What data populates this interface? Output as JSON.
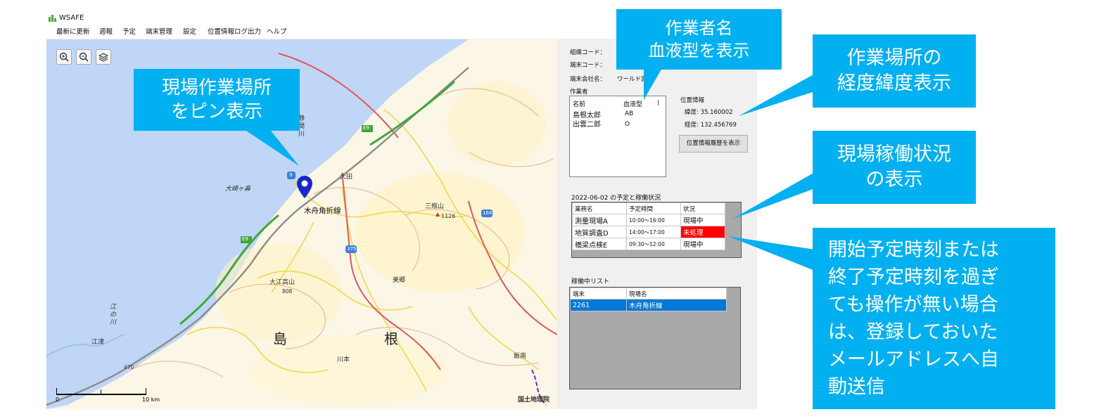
{
  "window": {
    "title": "WSAFE"
  },
  "menu": [
    {
      "label": "最新に更新"
    },
    {
      "label": "週報"
    },
    {
      "label": "予定"
    },
    {
      "label": "端末管理"
    },
    {
      "label": "設定"
    },
    {
      "label": "位置情報ログ出力"
    },
    {
      "label": "ヘルプ"
    }
  ],
  "map": {
    "controls": {
      "zoom_in_icon": "zoom-in-icon",
      "zoom_out_icon": "zoom-out-icon",
      "layers_icon": "layers-icon"
    },
    "pin_label": "木舟角折線",
    "labels": {
      "shizuma": "静間川",
      "ota": "大田",
      "osakigahana": "大崎ヶ鼻",
      "sanbesan": "三瓶山",
      "sanbe_elev": "1126",
      "oeta": "大江高山",
      "oeta_elev": "808",
      "gonokawa": "江の川",
      "gotsu": "江津",
      "misato": "美郷",
      "kawamoto": "川本",
      "iinan": "飯南",
      "shima": "島",
      "ne": "根",
      "elev470": "470",
      "gsi": "国土地理院",
      "route184": "184",
      "route375": "375",
      "route9": "9",
      "e9_a": "E9",
      "e9_b": "E9"
    },
    "scale": {
      "start": "0",
      "end": "10 km"
    }
  },
  "panel": {
    "org_code_label": "組織コード：",
    "terminal_code_label": "端末コード：",
    "company_label": "端末会社名：",
    "company_value": "ワールド測",
    "workers_label": "作業者",
    "workers_columns": [
      "名前",
      "血液型"
    ],
    "workers": [
      {
        "name": "島根太郎",
        "blood": "AB"
      },
      {
        "name": "出雲二郎",
        "blood": "O"
      }
    ],
    "position": {
      "label": "位置情報",
      "lat": "緯度: 35.160002",
      "lon": "経度: 132.456769",
      "history_button": "位置情報履歴を表示"
    },
    "schedule": {
      "title": "2022-06-02 の予定と稼働状況",
      "columns": [
        "業務名",
        "予定時間",
        "状況"
      ],
      "rows": [
        {
          "name": "測量現場A",
          "time": "10:00～16:00",
          "status": "現場中"
        },
        {
          "name": "地質調査D",
          "time": "14:00～17:00",
          "status": "未処理"
        },
        {
          "name": "橋梁点検E",
          "time": "09:30～12:00",
          "status": "現場中"
        }
      ]
    },
    "active": {
      "title": "稼働中リスト",
      "columns": [
        "端末",
        "現場名"
      ],
      "rows": [
        {
          "terminal": "2261",
          "site": "木舟角折線"
        }
      ]
    }
  },
  "callouts": {
    "worker": [
      "作業者名",
      "血液型を表示"
    ],
    "pin": [
      "現場作業場所",
      "をピン表示"
    ],
    "coords": [
      "作業場所の",
      "経度緯度表示"
    ],
    "status": [
      "現場稼働状況",
      "の表示"
    ],
    "alert": [
      "開始予定時刻または",
      "終了予定時刻を過ぎ",
      "ても操作が無い場合",
      "は、登録しておいた",
      "メールアドレスへ自",
      "動送信"
    ]
  },
  "colors": {
    "callout": "#00b0f0",
    "sea": "#bfd6f6",
    "overdue": "#ff0000",
    "selection": "#0078d7",
    "pin": "#1a28c8"
  }
}
